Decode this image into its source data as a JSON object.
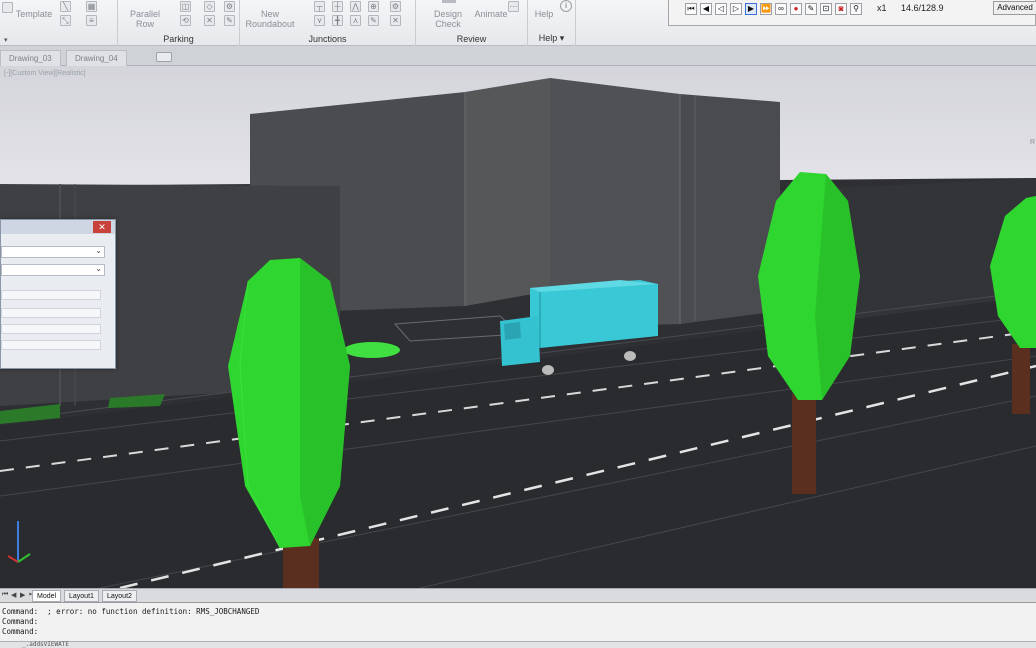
{
  "ribbon": {
    "template_label": "Template",
    "parallel_row_label": "Parallel\nRow",
    "new_roundabout_label": "New\nRoundabout",
    "design_check_label": "Design Check",
    "animate_label": "Animate",
    "help_label": "Help",
    "panels": {
      "parking": "Parking",
      "junctions": "Junctions",
      "review": "Review",
      "help": "Help"
    }
  },
  "animation_toolbar": {
    "speed": "x1",
    "time": "14.6/128.9",
    "advanced_label": "Advanced"
  },
  "drawing_tabs": [
    "Drawing_03",
    "Drawing_04"
  ],
  "viewport": {
    "label": "[-][Custom View][Realistic]"
  },
  "layout_tabs": [
    "Model",
    "Layout1",
    "Layout2"
  ],
  "command_window": {
    "lines": [
      "Command:  ; error: no function definition: RMS_JOBCHANGED",
      "Command:",
      "Command:"
    ],
    "input": "_.addsVIEWATE"
  },
  "colors": {
    "tree_foliage": "#2fd62f",
    "tree_trunk": "#5a2f1f",
    "truck": "#39c9d6",
    "road": "#2b2c30",
    "building": "#4a4b4e",
    "sky": "#d5d7de",
    "close_button": "#c8413a"
  }
}
